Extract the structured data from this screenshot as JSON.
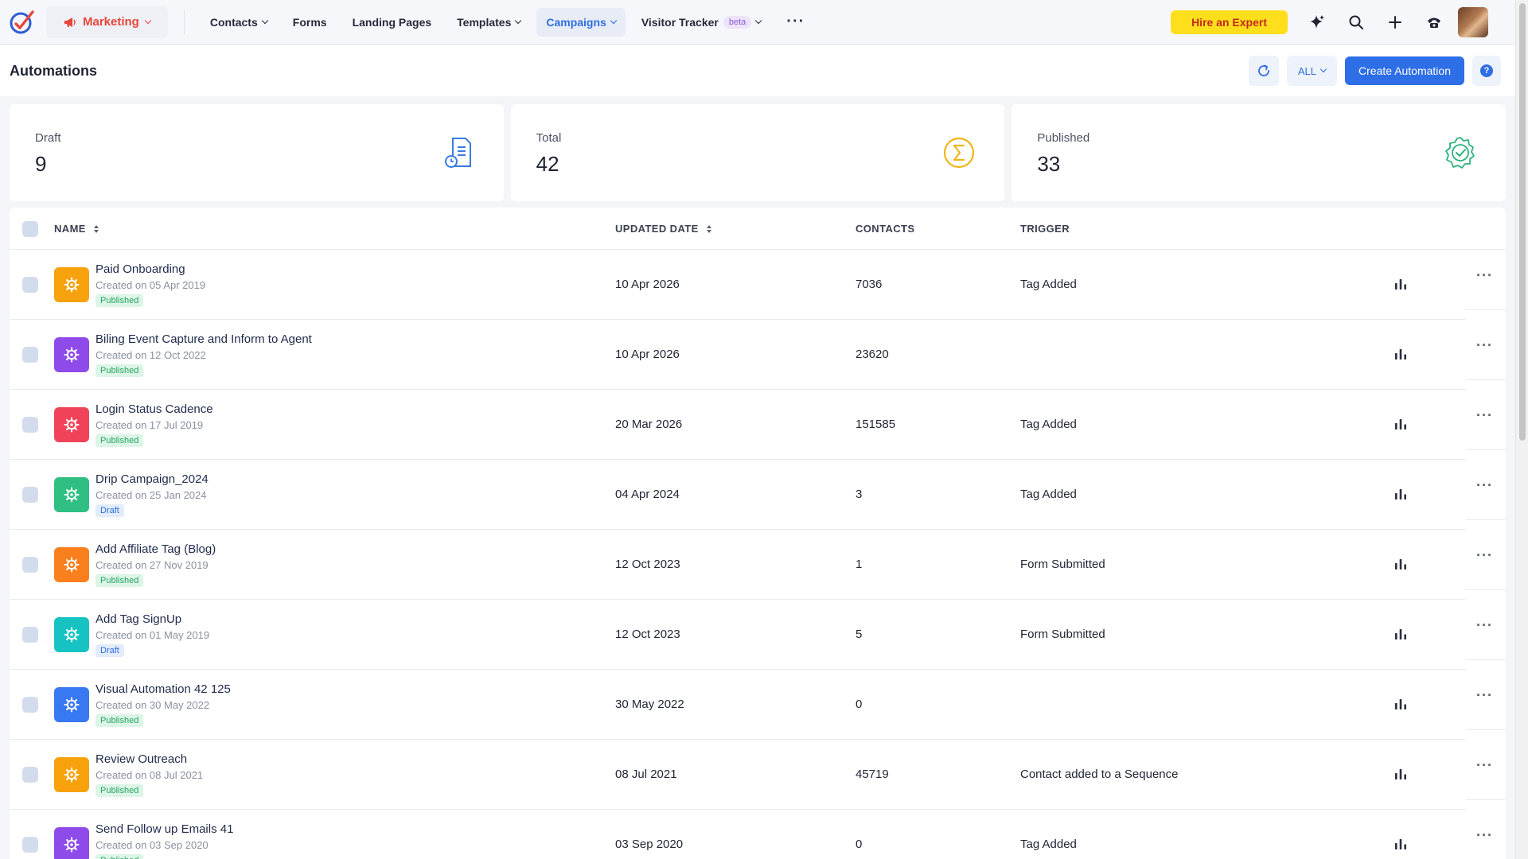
{
  "nav": {
    "module_label": "Marketing",
    "items": [
      {
        "label": "Contacts",
        "dropdown": true,
        "active": false
      },
      {
        "label": "Forms",
        "dropdown": false,
        "active": false
      },
      {
        "label": "Landing Pages",
        "dropdown": false,
        "active": false
      },
      {
        "label": "Templates",
        "dropdown": true,
        "active": false
      },
      {
        "label": "Campaigns",
        "dropdown": true,
        "active": true
      },
      {
        "label": "Visitor Tracker",
        "dropdown": true,
        "active": false,
        "badge": "beta"
      }
    ],
    "more": "···",
    "hire_expert": "Hire an Expert"
  },
  "page": {
    "title": "Automations",
    "filter": "ALL",
    "create_button": "Create Automation",
    "help": "?"
  },
  "stats": [
    {
      "label": "Draft",
      "value": "9",
      "icon": "document-clock-icon",
      "color": "#3a7be0"
    },
    {
      "label": "Total",
      "value": "42",
      "icon": "sigma-icon",
      "color": "#f0b415"
    },
    {
      "label": "Published",
      "value": "33",
      "icon": "verified-badge-icon",
      "color": "#2bb47a"
    }
  ],
  "table": {
    "columns": {
      "name": "NAME",
      "updated": "UPDATED DATE",
      "contacts": "CONTACTS",
      "trigger": "TRIGGER"
    },
    "rows": [
      {
        "name": "Paid Onboarding",
        "created": "Created on 05 Apr 2019",
        "status": "Published",
        "updated": "10 Apr 2026",
        "contacts": "7036",
        "trigger": "Tag Added",
        "color": "#f7a20c"
      },
      {
        "name": "Biling Event Capture and Inform to Agent",
        "created": "Created on 12 Oct 2022",
        "status": "Published",
        "updated": "10 Apr 2026",
        "contacts": "23620",
        "trigger": "",
        "color": "#8f4bea"
      },
      {
        "name": "Login Status Cadence",
        "created": "Created on 17 Jul 2019",
        "status": "Published",
        "updated": "20 Mar 2026",
        "contacts": "151585",
        "trigger": "Tag Added",
        "color": "#f0435a"
      },
      {
        "name": "Drip Campaign_2024",
        "created": "Created on 25 Jan 2024",
        "status": "Draft",
        "updated": "04 Apr 2024",
        "contacts": "3",
        "trigger": "Tag Added",
        "color": "#2fbf82"
      },
      {
        "name": "Add Affiliate Tag (Blog)",
        "created": "Created on 27 Nov 2019",
        "status": "Published",
        "updated": "12 Oct 2023",
        "contacts": "1",
        "trigger": "Form Submitted",
        "color": "#f9801d"
      },
      {
        "name": "Add Tag SignUp",
        "created": "Created on 01 May 2019",
        "status": "Draft",
        "updated": "12 Oct 2023",
        "contacts": "5",
        "trigger": "Form Submitted",
        "color": "#17c2c2"
      },
      {
        "name": "Visual Automation 42 125",
        "created": "Created on 30 May 2022",
        "status": "Published",
        "updated": "30 May 2022",
        "contacts": "0",
        "trigger": "",
        "color": "#3878f0"
      },
      {
        "name": "Review Outreach",
        "created": "Created on 08 Jul 2021",
        "status": "Published",
        "updated": "08 Jul 2021",
        "contacts": "45719",
        "trigger": "Contact added to a Sequence",
        "color": "#f7a20c"
      },
      {
        "name": "Send Follow up Emails 41",
        "created": "Created on 03 Sep 2020",
        "status": "Published",
        "updated": "03 Sep 2020",
        "contacts": "0",
        "trigger": "Tag Added",
        "color": "#8f4bea"
      }
    ]
  }
}
